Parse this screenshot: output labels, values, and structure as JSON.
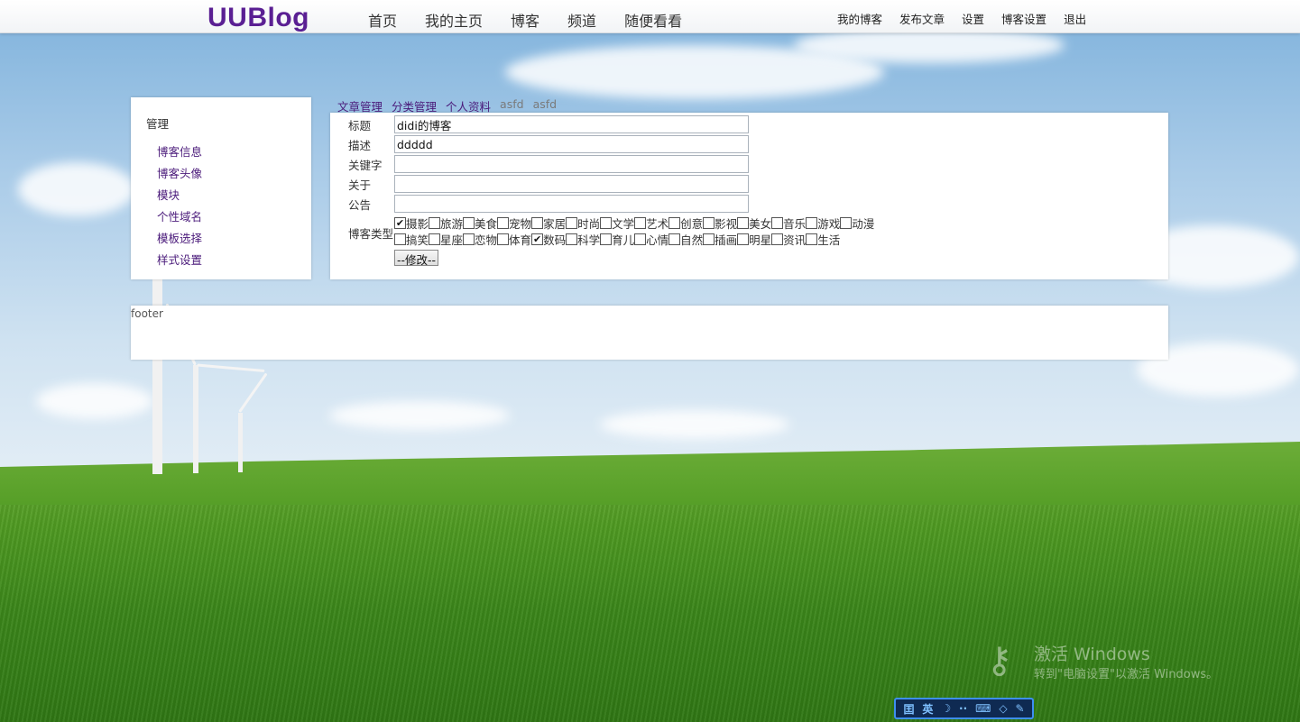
{
  "header": {
    "logo": "UUBlog",
    "main_nav": [
      "首页",
      "我的主页",
      "博客",
      "频道",
      "随便看看"
    ],
    "user_nav": [
      "我的博客",
      "发布文章",
      "设置",
      "博客设置",
      "退出"
    ]
  },
  "sidebar": {
    "heading": "管理",
    "items": [
      "博客信息",
      "博客头像",
      "模块",
      "个性域名",
      "模板选择",
      "样式设置"
    ]
  },
  "tabs": [
    {
      "label": "文章管理",
      "state": "link"
    },
    {
      "label": "分类管理",
      "state": "link"
    },
    {
      "label": "个人资料",
      "state": "link"
    },
    {
      "label": "asfd",
      "state": "muted"
    },
    {
      "label": "asfd",
      "state": "muted"
    }
  ],
  "form": {
    "title_label": "标题",
    "title_value": "didi的博客",
    "desc_label": "描述",
    "desc_value": "ddddd",
    "keywords_label": "关键字",
    "keywords_value": "",
    "about_label": "关于",
    "about_value": "",
    "notice_label": "公告",
    "notice_value": "",
    "types_label": "博客类型",
    "type_rows": [
      [
        {
          "label": "摄影",
          "checked": true
        },
        {
          "label": "旅游",
          "checked": false
        },
        {
          "label": "美食",
          "checked": false
        },
        {
          "label": "宠物",
          "checked": false
        },
        {
          "label": "家居",
          "checked": false
        },
        {
          "label": "时尚",
          "checked": false
        },
        {
          "label": "文学",
          "checked": false
        },
        {
          "label": "艺术",
          "checked": false
        },
        {
          "label": "创意",
          "checked": false
        },
        {
          "label": "影视",
          "checked": false
        },
        {
          "label": "美女",
          "checked": false
        },
        {
          "label": "音乐",
          "checked": false
        },
        {
          "label": "游戏",
          "checked": false
        },
        {
          "label": "动漫",
          "checked": false
        }
      ],
      [
        {
          "label": "搞笑",
          "checked": false
        },
        {
          "label": "星座",
          "checked": false
        },
        {
          "label": "恋物",
          "checked": false
        },
        {
          "label": "体育",
          "checked": false
        },
        {
          "label": "数码",
          "checked": true
        },
        {
          "label": "科学",
          "checked": false
        },
        {
          "label": "育儿",
          "checked": false
        },
        {
          "label": "心情",
          "checked": false
        },
        {
          "label": "自然",
          "checked": false
        },
        {
          "label": "插画",
          "checked": false
        },
        {
          "label": "明星",
          "checked": false
        },
        {
          "label": "资讯",
          "checked": false
        },
        {
          "label": "生活",
          "checked": false
        }
      ]
    ],
    "submit_label": "--修改--"
  },
  "footer": {
    "text": "footer"
  },
  "watermark": {
    "title": "激活 Windows",
    "subtitle": "转到\"电脑设置\"以激活 Windows。"
  },
  "ime": {
    "buttons": [
      "囯",
      "英",
      "☽",
      "··",
      "⌨",
      "◇",
      "✎"
    ]
  },
  "colors": {
    "logo": "#5a1f93",
    "link_purple": "#4a1a7a",
    "muted_tab": "#7a7a7a",
    "panel_bg": "#ffffff",
    "ime_bg": "#0f2a52",
    "ime_border": "#3e8ff0"
  }
}
